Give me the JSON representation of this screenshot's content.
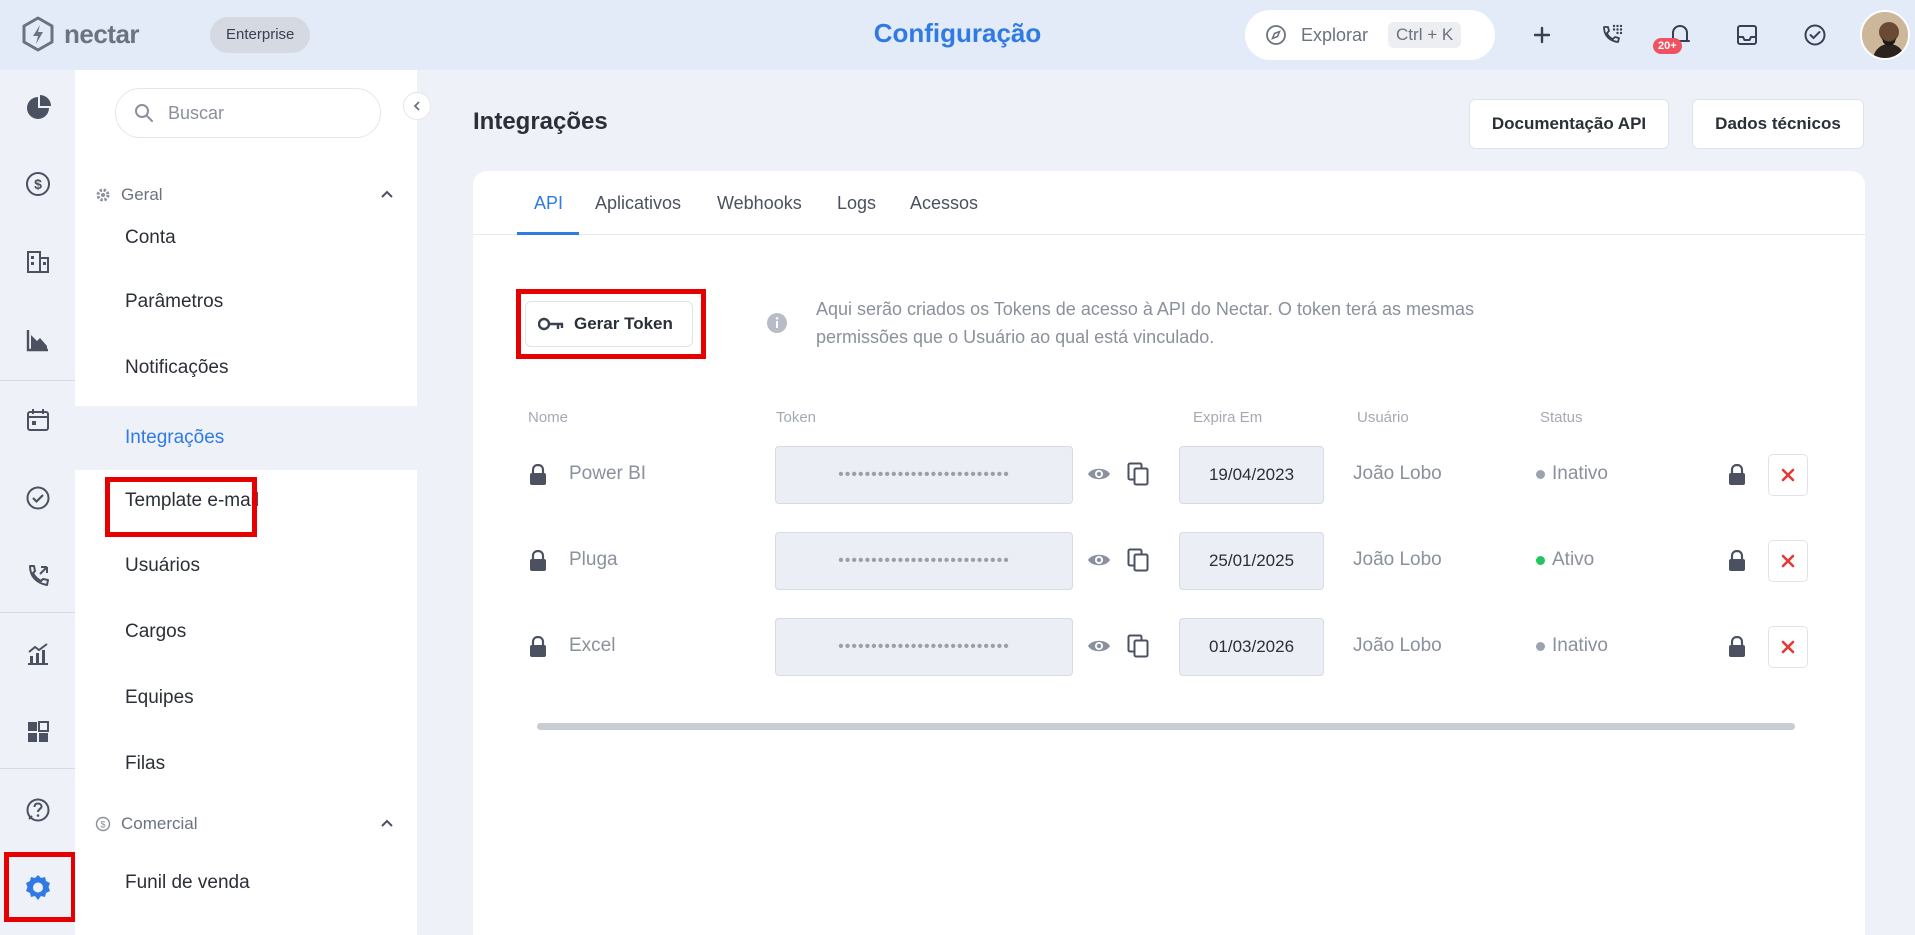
{
  "brand": {
    "name": "nectar",
    "plan": "Enterprise"
  },
  "header": {
    "title": "Configuração",
    "explore_label": "Explorar",
    "explore_shortcut": "Ctrl + K",
    "notifications_badge": "20+"
  },
  "rail": {
    "items": [
      "dashboard-icon",
      "dollar-icon",
      "building-icon",
      "chart-down-icon",
      "calendar-icon",
      "check-circle-icon",
      "phone-icon",
      "chart-up-icon",
      "widgets-icon",
      "help-icon",
      "settings-icon"
    ],
    "active": "settings-icon"
  },
  "sidebar": {
    "search_placeholder": "Buscar",
    "groups": [
      {
        "label": "Geral",
        "items": [
          "Conta",
          "Parâmetros",
          "Notificações",
          "Integrações",
          "Template e-mail",
          "Usuários",
          "Cargos",
          "Equipes",
          "Filas"
        ]
      },
      {
        "label": "Comercial",
        "items": [
          "Funil de venda"
        ]
      }
    ],
    "active_item": "Integrações"
  },
  "main": {
    "title": "Integrações",
    "doc_button": "Documentação API",
    "tech_button": "Dados técnicos",
    "tabs": [
      "API",
      "Aplicativos",
      "Webhooks",
      "Logs",
      "Acessos"
    ],
    "active_tab": "API",
    "generate_token_label": "Gerar Token",
    "info_text": "Aqui serão criados os Tokens de acesso à API do Nectar. O token terá as mesmas permissões que o Usuário ao qual está vinculado.",
    "table": {
      "headers": [
        "Nome",
        "Token",
        "Expira Em",
        "Usuário",
        "Status"
      ],
      "rows": [
        {
          "name": "Power BI",
          "token": "••••••••••••••••••••••••••",
          "expires": "19/04/2023",
          "user": "João Lobo",
          "status": "Inativo"
        },
        {
          "name": "Pluga",
          "token": "••••••••••••••••••••••••••",
          "expires": "25/01/2025",
          "user": "João Lobo",
          "status": "Ativo"
        },
        {
          "name": "Excel",
          "token": "••••••••••••••••••••••••••",
          "expires": "01/03/2026",
          "user": "João Lobo",
          "status": "Inativo"
        }
      ]
    }
  },
  "colors": {
    "accent": "#2f7ae5",
    "active_status": "#22c55e",
    "inactive_status": "#9ca3af",
    "delete": "#e53935",
    "highlight": "#e60000"
  }
}
